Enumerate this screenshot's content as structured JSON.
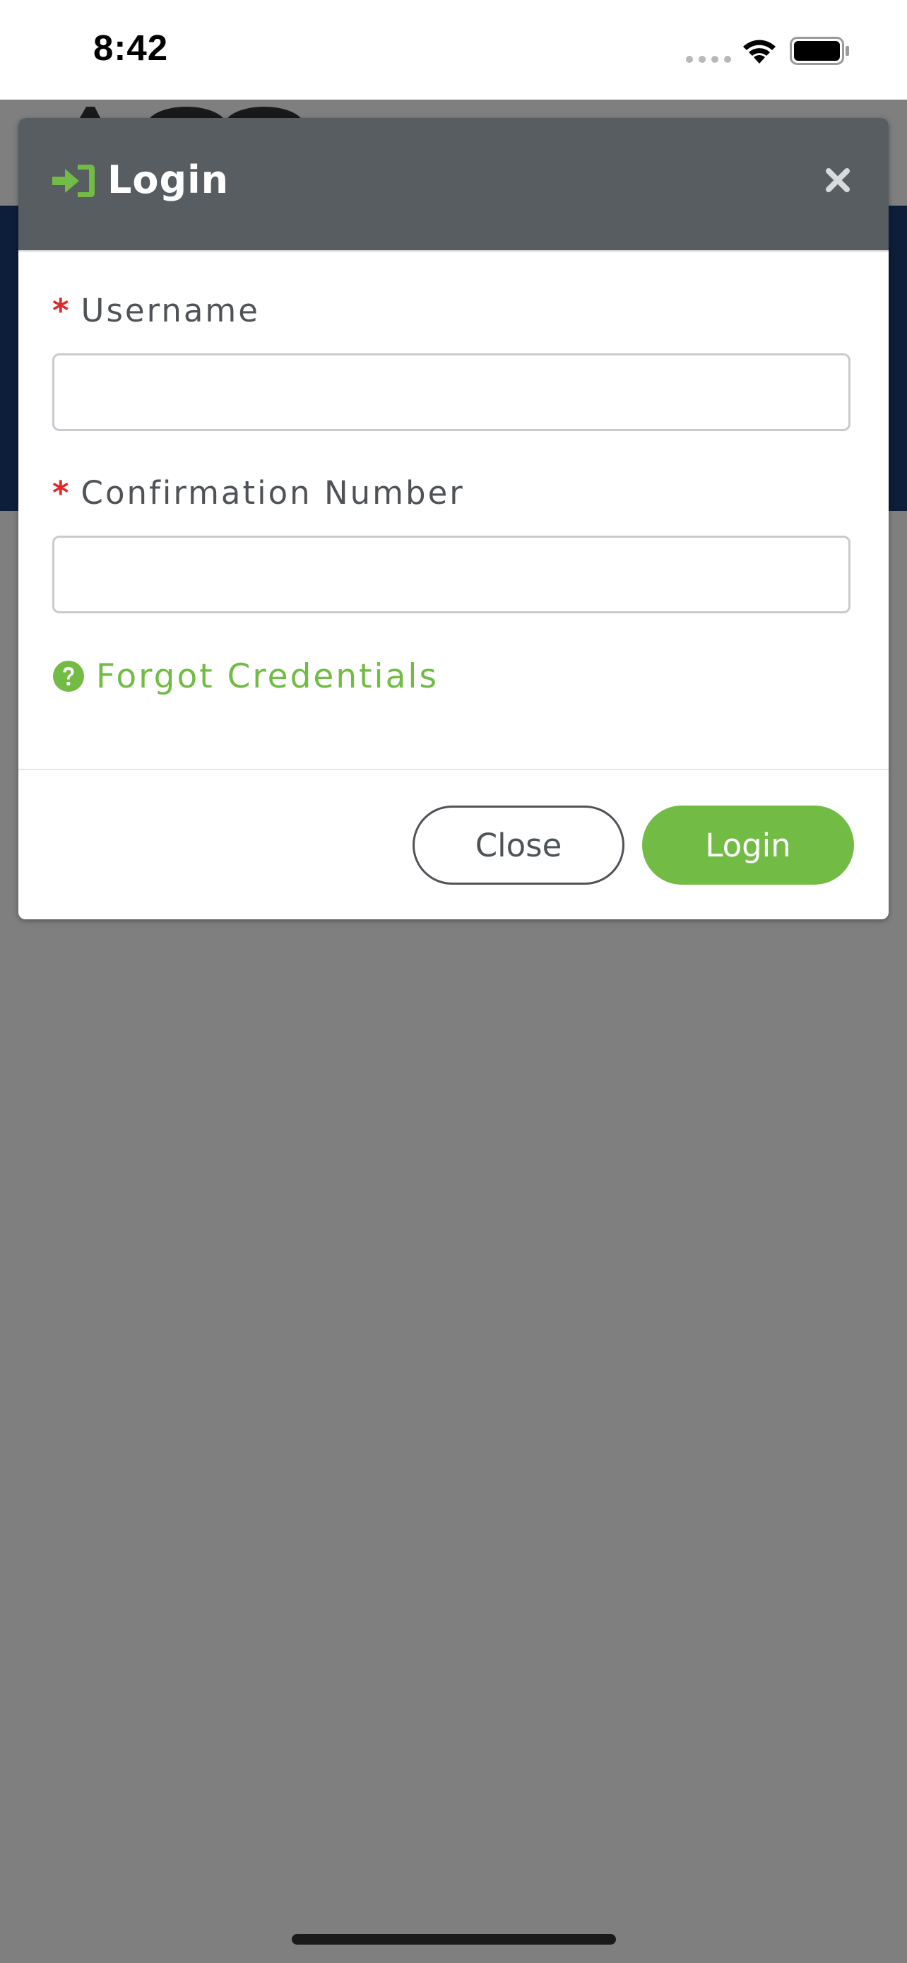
{
  "status_bar": {
    "time": "8:42",
    "signal_icon": "cellular-signal-icon",
    "wifi_icon": "wifi-icon",
    "battery_icon": "battery-full-icon"
  },
  "modal": {
    "title": "Login",
    "title_icon": "sign-in-icon",
    "close_icon": "close-icon",
    "fields": [
      {
        "required_mark": "*",
        "label": "Username",
        "value": "",
        "placeholder": ""
      },
      {
        "required_mark": "*",
        "label": "Confirmation Number",
        "value": "",
        "placeholder": ""
      }
    ],
    "forgot": {
      "icon": "question-circle-icon",
      "label": "Forgot Credentials"
    },
    "buttons": {
      "close_label": "Close",
      "login_label": "Login"
    }
  },
  "colors": {
    "accent_green": "#72bb45",
    "modal_header": "#575d61",
    "required_red": "#e02828",
    "banner_blue": "#1b3c74",
    "overlay": "#808080"
  }
}
